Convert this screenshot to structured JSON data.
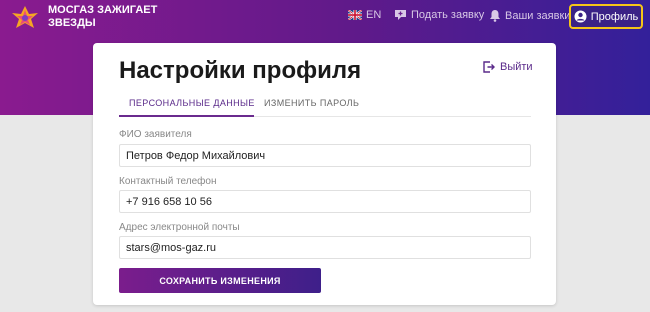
{
  "header": {
    "brand_text": "МОСГАЗ ЗАЖИГАЕТ\nЗВЕЗДЫ",
    "lang_label": "EN",
    "apply_label": "Подать заявку",
    "orders_label": "Ваши заявки",
    "profile_label": "Профиль"
  },
  "page": {
    "title": "Настройки профиля",
    "logout_label": "Выйти"
  },
  "tabs": [
    {
      "label": "ПЕРСОНАЛЬНЫЕ ДАННЫЕ",
      "active": true
    },
    {
      "label": "ИЗМЕНИТЬ ПАРОЛЬ",
      "active": false
    }
  ],
  "form": {
    "name_label": "ФИО заявителя",
    "name_value": "Петров Федор Михайлович",
    "phone_label": "Контактный телефон",
    "phone_value": "+7 916 658 10 56",
    "email_label": "Адрес электронной почты",
    "email_value": "stars@mos-gaz.ru",
    "save_label": "СОХРАНИТЬ ИЗМЕНЕНИЯ"
  },
  "colors": {
    "accent": "#6a2a8e",
    "highlight_border": "#f5c518"
  },
  "icons": [
    "logo-icon",
    "uk-flag-icon",
    "add-request-icon",
    "bell-icon",
    "user-circle-icon",
    "logout-icon"
  ]
}
